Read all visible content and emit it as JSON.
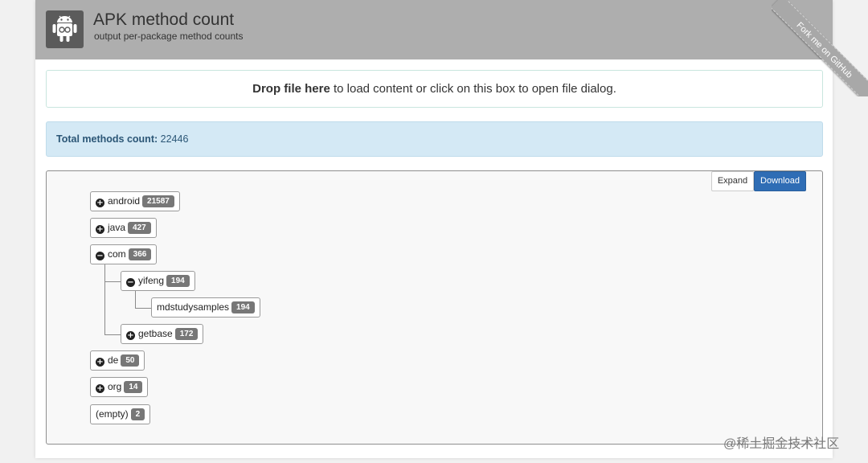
{
  "header": {
    "title": "APK method count",
    "subtitle": "output per-package method counts",
    "logo_icon": "android-icon"
  },
  "drop_zone": {
    "bold_text": "Drop file here",
    "text": " to load content or click on this box to open file dialog."
  },
  "total": {
    "label": "Total methods count:",
    "value": "22446"
  },
  "toolbar": {
    "expand_label": "Expand",
    "download_label": "Download"
  },
  "tree": {
    "android": {
      "name": "android",
      "count": "21587",
      "state": "collapsed"
    },
    "java": {
      "name": "java",
      "count": "427",
      "state": "collapsed"
    },
    "com": {
      "name": "com",
      "count": "366",
      "state": "expanded"
    },
    "yifeng": {
      "name": "yifeng",
      "count": "194",
      "state": "expanded"
    },
    "mdstudysamples": {
      "name": "mdstudysamples",
      "count": "194",
      "state": "leaf"
    },
    "getbase": {
      "name": "getbase",
      "count": "172",
      "state": "collapsed"
    },
    "de": {
      "name": "de",
      "count": "50",
      "state": "collapsed"
    },
    "org": {
      "name": "org",
      "count": "14",
      "state": "collapsed"
    },
    "empty": {
      "name": "(empty)",
      "count": "2",
      "state": "leaf"
    }
  },
  "ribbon": {
    "text": "Fork me on GitHub"
  },
  "watermark": {
    "text": "@稀土掘金技术社区"
  },
  "colors": {
    "header": "#aeaeae",
    "primary": "#2f6db5",
    "info_bg": "#d4e9f5",
    "badge": "#777777"
  }
}
